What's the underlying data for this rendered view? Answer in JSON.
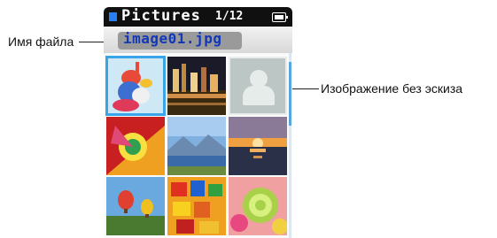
{
  "screen": {
    "title": "Pictures",
    "counter": "1/12",
    "filename": "image01.jpg",
    "accent_color": "#2a7ff0",
    "filename_color": "#1238b8",
    "selection_color": "#3aa4e8",
    "scroll_position": {
      "current": 1,
      "total": 12
    }
  },
  "annotations": {
    "filename_label": "Имя файла",
    "no_thumbnail_label": "Изображение без эскиза"
  },
  "thumbnails": [
    {
      "icon": "rabbit-figurine-photo",
      "selected": true
    },
    {
      "icon": "city-night-photo",
      "selected": false
    },
    {
      "icon": "placeholder-person-icon",
      "selected": false
    },
    {
      "icon": "colorful-shell-photo",
      "selected": false
    },
    {
      "icon": "mountain-lake-photo",
      "selected": false
    },
    {
      "icon": "sunset-sea-photo",
      "selected": false
    },
    {
      "icon": "balloon-photo",
      "selected": false
    },
    {
      "icon": "colorful-blocks-photo",
      "selected": false
    },
    {
      "icon": "candy-photo",
      "selected": false
    }
  ]
}
